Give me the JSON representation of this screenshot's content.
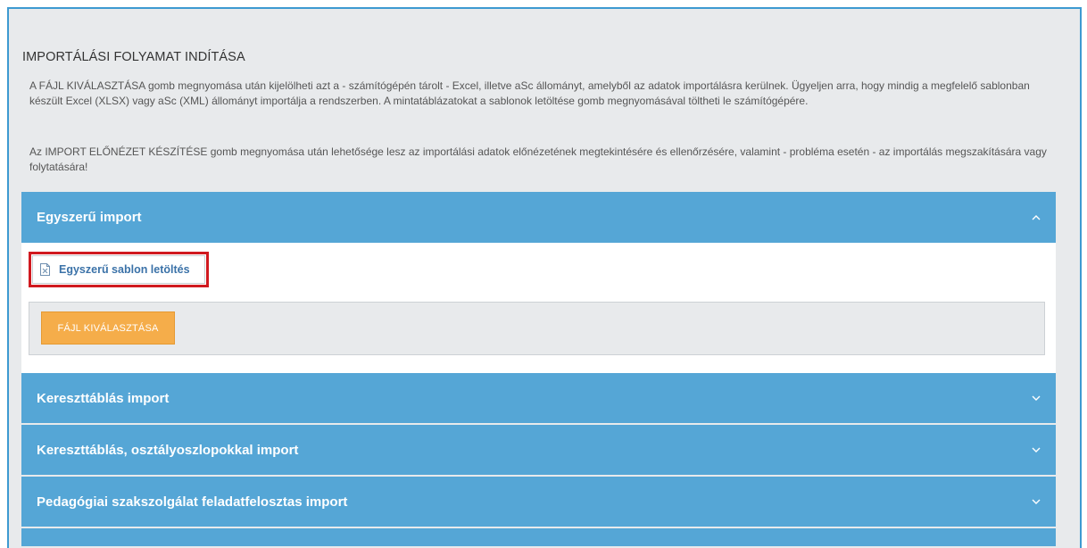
{
  "section": {
    "title": "IMPORTÁLÁSI FOLYAMAT INDÍTÁSA",
    "paragraph1": "A FÁJL KIVÁLASZTÁSA gomb megnyomása után kijelölheti azt a - számítógépén tárolt - Excel, illetve aSc állományt, amelyből az adatok importálásra kerülnek. Ügyeljen arra, hogy mindig a megfelelő sablonban készült Excel (XLSX) vagy aSc (XML) állományt importálja a rendszerben. A mintatáblázatokat a sablonok letöltése gomb megnyomásával töltheti le számítógépére.",
    "paragraph2": "Az IMPORT ELŐNÉZET KÉSZÍTÉSE gomb megnyomása után lehetősége lesz az importálási adatok előnézetének megtekintésére és ellenőrzésére, valamint - probléma esetén - az importálás megszakítására vagy folytatására!"
  },
  "accordion": {
    "items": [
      {
        "label": "Egyszerű import",
        "expanded": true
      },
      {
        "label": "Kereszttáblás import",
        "expanded": false
      },
      {
        "label": "Kereszttáblás, osztályoszlopokkal import",
        "expanded": false
      },
      {
        "label": "Pedagógiai szakszolgálat feladatfelosztas import",
        "expanded": false
      }
    ],
    "open_panel": {
      "template_download_label": "Egyszerű sablon letöltés",
      "template_icon": "excel-file-icon",
      "file_select_label": "FÁJL KIVÁLASZTÁSA"
    }
  },
  "colors": {
    "accordion_header": "#55a6d6",
    "highlight_border": "#d0191f",
    "file_button": "#f5ad4a",
    "link": "#3b72a8",
    "frame_border": "#3d9ad1"
  }
}
